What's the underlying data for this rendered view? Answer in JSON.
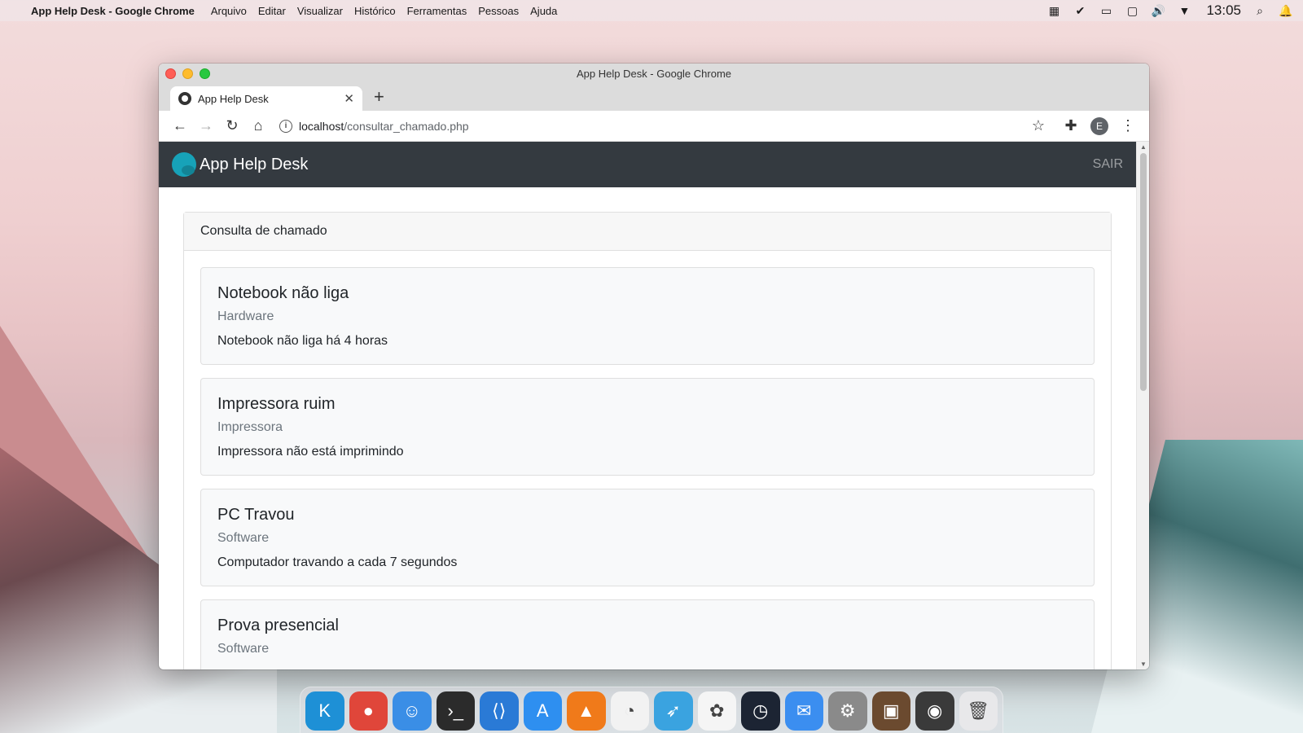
{
  "menubar": {
    "app_name": "App Help Desk - Google Chrome",
    "items": [
      "Arquivo",
      "Editar",
      "Visualizar",
      "Histórico",
      "Ferramentas",
      "Pessoas",
      "Ajuda"
    ],
    "clock": "13:05"
  },
  "window": {
    "title": "App Help Desk - Google Chrome",
    "tab_title": "App Help Desk",
    "url_host": "localhost",
    "url_path": "/consultar_chamado.php",
    "profile_initial": "E"
  },
  "page": {
    "brand": "App Help Desk",
    "logout": "SAIR",
    "card_header": "Consulta de chamado",
    "tickets": [
      {
        "title": "Notebook não liga",
        "category": "Hardware",
        "description": "Notebook não liga há 4 horas"
      },
      {
        "title": "Impressora ruim",
        "category": "Impressora",
        "description": "Impressora não está imprimindo"
      },
      {
        "title": "PC Travou",
        "category": "Software",
        "description": "Computador travando a cada 7 segundos"
      },
      {
        "title": "Prova presencial",
        "category": "Software",
        "description": ""
      }
    ]
  },
  "dock": {
    "apps": [
      {
        "name": "kde-connect-icon",
        "color": "#1e90d6",
        "glyph": "K"
      },
      {
        "name": "chrome-icon",
        "color": "#e0463a",
        "glyph": "●"
      },
      {
        "name": "finder-icon",
        "color": "#3a8ee6",
        "glyph": "☺"
      },
      {
        "name": "terminal-icon",
        "color": "#2b2b2b",
        "glyph": "›_"
      },
      {
        "name": "vscode-icon",
        "color": "#2a7ad6",
        "glyph": "⟨⟩"
      },
      {
        "name": "app-store-icon",
        "color": "#2e8ff0",
        "glyph": "A"
      },
      {
        "name": "vlc-icon",
        "color": "#f07a1a",
        "glyph": "▲"
      },
      {
        "name": "clock-icon",
        "color": "#f2f2f2",
        "glyph": "◔"
      },
      {
        "name": "swift-icon",
        "color": "#3aa3e0",
        "glyph": "➶"
      },
      {
        "name": "photos-icon",
        "color": "#f5f5f5",
        "glyph": "✿"
      },
      {
        "name": "speedometer-icon",
        "color": "#1c2433",
        "glyph": "◷"
      },
      {
        "name": "mail-icon",
        "color": "#3b8ef0",
        "glyph": "✉"
      },
      {
        "name": "system-preferences-icon",
        "color": "#8a8a8a",
        "glyph": "⚙"
      },
      {
        "name": "package-icon",
        "color": "#6b4a2f",
        "glyph": "▣"
      },
      {
        "name": "camera-icon",
        "color": "#3a3a3a",
        "glyph": "◉"
      },
      {
        "name": "trash-icon",
        "color": "#e8e8ea",
        "glyph": "🗑"
      }
    ]
  }
}
